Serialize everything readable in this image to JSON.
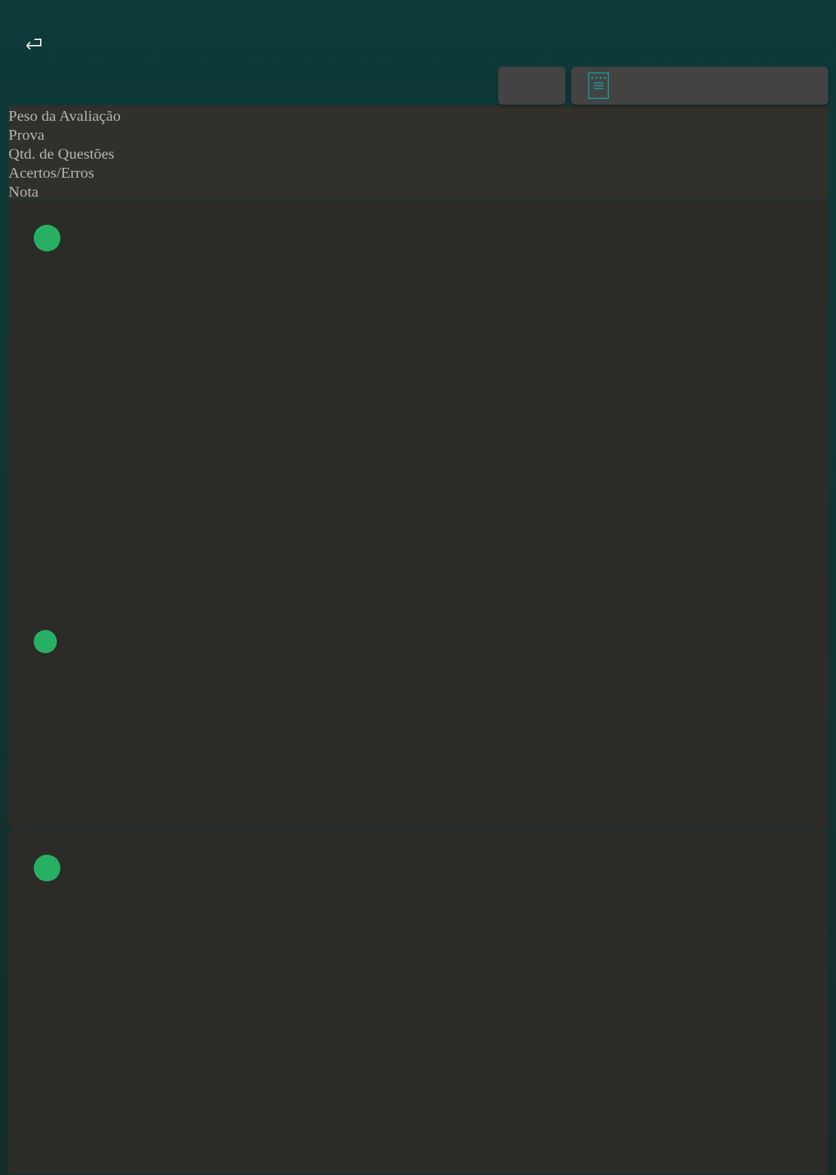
{
  "header": {
    "labels": [
      "Peso da Avaliação",
      "Prova",
      "Qtd. de Questões",
      "Acertos/Erros",
      "Nota"
    ]
  },
  "cards": [
    {
      "dots": [
        {
          "color": "#27b062"
        },
        {
          "color": "#27b062"
        }
      ]
    },
    {
      "dots": [
        {
          "color": "#27b062"
        }
      ]
    }
  ]
}
